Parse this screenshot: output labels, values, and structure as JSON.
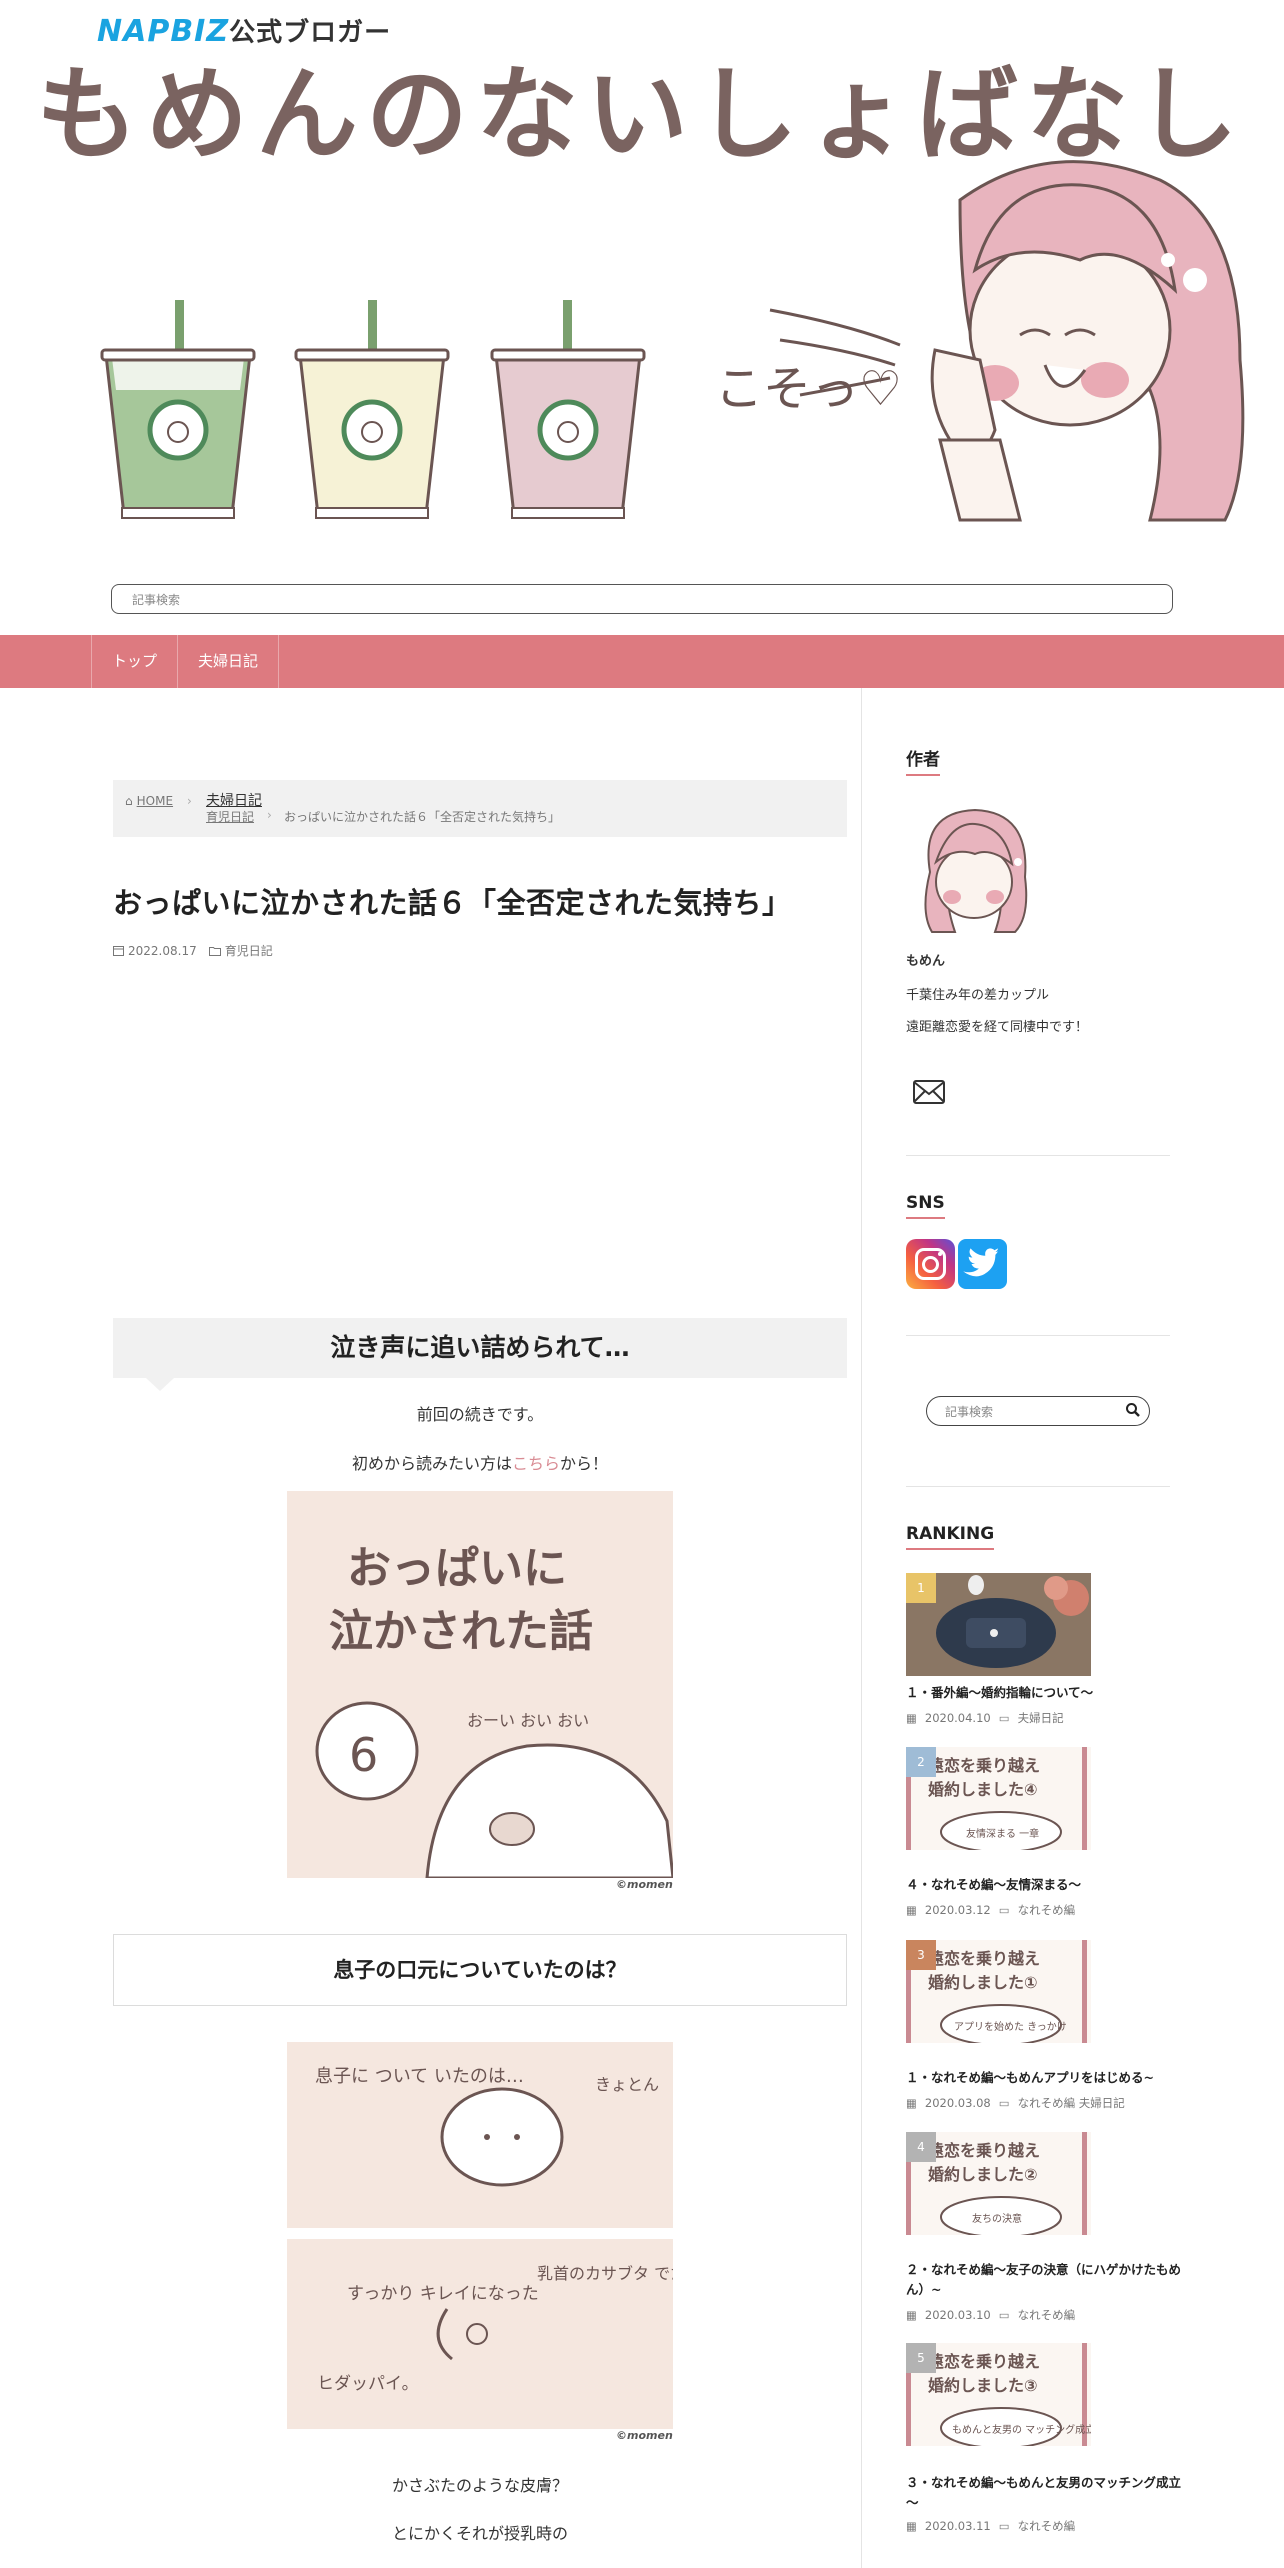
{
  "header": {
    "napbiz_brand": "NAPBIZ",
    "napbiz_suffix": "公式ブロガー",
    "site_title": "もめんのないしょばなし",
    "kosotto": "こそっ♡",
    "search_placeholder": "記事検索"
  },
  "nav": {
    "items": [
      "トップ",
      "夫婦日記"
    ]
  },
  "breadcrumb": {
    "home": "HOME",
    "category": "夫婦日記",
    "subcategory": "育児日記",
    "current": "おっぱいに泣かされた話６「全否定された気持ち」"
  },
  "post": {
    "title": "おっぱいに泣かされた話６「全否定された気持ち」",
    "date": "2022.08.17",
    "category": "育児日記",
    "h2": "泣き声に追い詰められて…",
    "p1": "前回の続きです。",
    "p2_before": "初めから読みたい方は",
    "p2_link": "こちら",
    "p2_after": "から！",
    "comic1": {
      "title_line1": "おっぱいに",
      "title_line2": "泣かされた話",
      "number": "6",
      "sfx": "おーい おい おい",
      "credit": "©momen"
    },
    "h3": "息子の口元についていたのは？",
    "comic2": {
      "text_a": "息子に ついて いたのは…",
      "text_b": "きょとん",
      "text_c": "乳首のカサブタ でた!!",
      "text_d": "すっかり キレイになった",
      "text_e": "ヒダッパイ。",
      "credit": "©momen"
    },
    "p3": "かさぶたのような皮膚？",
    "p4": "とにかくそれが授乳時の"
  },
  "sidebar": {
    "author_heading": "作者",
    "author_name": "もめん",
    "author_line1": "千葉住み年の差カップル",
    "author_line2": "遠距離恋愛を経て同棲中です！",
    "sns_heading": "SNS",
    "search_placeholder": "記事検索",
    "ranking_heading": "RANKING",
    "ranking": [
      {
        "rank": "1",
        "title": "１・番外編～婚約指輪について～",
        "date": "2020.04.10",
        "categories": "夫婦日記",
        "badge_color": "#e8c468"
      },
      {
        "rank": "2",
        "title": "４・なれそめ編～友情深まる～",
        "date": "2020.03.12",
        "categories": "なれそめ編",
        "badge_color": "#9fbcd6",
        "thumb_line1": "遠恋を乗り越え",
        "thumb_line2": "婚約しました④",
        "thumb_bubble": "友情深まる 一章"
      },
      {
        "rank": "3",
        "title": "１・なれそめ編～もめんアプリをはじめる~",
        "date": "2020.03.08",
        "categories": "なれそめ編  夫婦日記",
        "badge_color": "#c9855e",
        "thumb_line1": "遠恋を乗り越え",
        "thumb_line2": "婚約しました①",
        "thumb_bubble": "アプリを始めた きっかけ"
      },
      {
        "rank": "4",
        "title": "２・なれそめ編～友子の決意（にハゲかけたもめん）~",
        "date": "2020.03.10",
        "categories": "なれそめ編",
        "badge_color": "#b3b3b3",
        "thumb_line1": "遠恋を乗り越え",
        "thumb_line2": "婚約しました②",
        "thumb_bubble": "友ちの決意"
      },
      {
        "rank": "5",
        "title": "３・なれそめ編～もめんと友男のマッチング成立～",
        "date": "2020.03.11",
        "categories": "なれそめ編",
        "badge_color": "#b3b3b3",
        "thumb_line1": "遠恋を乗り越え",
        "thumb_line2": "婚約しました③",
        "thumb_bubble": "もめんと友男の マッチング成立"
      }
    ]
  }
}
